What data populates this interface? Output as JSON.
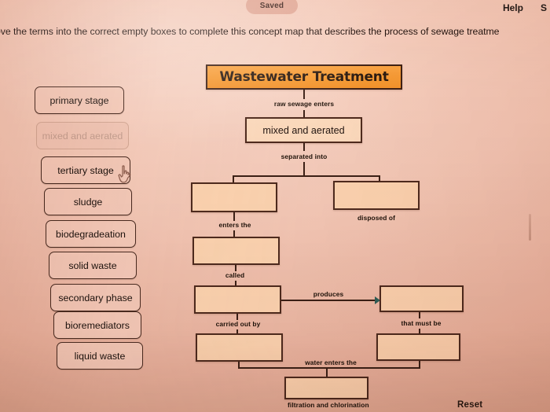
{
  "topbar": {
    "saved_badge": "Saved",
    "help_label": "Help",
    "save_label": "S"
  },
  "instruction": "ove the terms into the correct empty boxes to complete this concept map that describes the process of sewage treatme",
  "term_bank": {
    "items": [
      {
        "label": "primary stage",
        "used": false
      },
      {
        "label": "mixed and aerated",
        "used": true
      },
      {
        "label": "tertiary stage",
        "used": false
      },
      {
        "label": "sludge",
        "used": false
      },
      {
        "label": "biodegradeation",
        "used": false
      },
      {
        "label": "solid waste",
        "used": false
      },
      {
        "label": "secondary phase",
        "used": false
      },
      {
        "label": "bioremediators",
        "used": false
      },
      {
        "label": "liquid waste",
        "used": false
      }
    ]
  },
  "map": {
    "title_node": "Wastewater Treatment",
    "filled_node": "mixed and aerated",
    "edge_labels": {
      "raw_sewage": "raw sewage enters",
      "separated_into": "separated into",
      "enters_the": "enters the",
      "disposed_of": "disposed of",
      "called": "called",
      "produces": "produces",
      "carried_out_by": "carried out by",
      "that_must_be": "that must be",
      "water_enters_the": "water enters the",
      "filtration": "filtration and chlorination"
    },
    "empty_slots": [
      "",
      "",
      "",
      "",
      "",
      "",
      ""
    ]
  },
  "footer": {
    "reset_label": "Reset"
  },
  "colors": {
    "background": "#efc2b0",
    "title_fill": "#f59a33",
    "node_fill": "#fbd3b0",
    "node_border": "#4e2a1d",
    "term_fill": "#f3c9b8",
    "used_term_text": "#c49f90",
    "arrow": "#2f5f58"
  }
}
